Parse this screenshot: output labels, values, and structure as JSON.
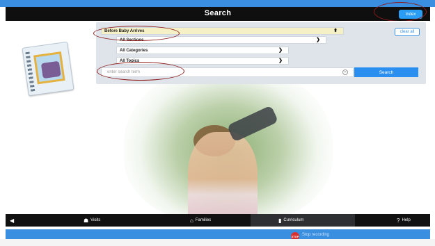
{
  "header": {
    "title": "Search",
    "index_label": "Index"
  },
  "filters": {
    "primary": {
      "value": "Before Baby Arrives"
    },
    "sections": {
      "value": "All Sections"
    },
    "categories": {
      "value": "All Categories"
    },
    "topics": {
      "value": "All Topics"
    },
    "clear_all": "clear all"
  },
  "search": {
    "placeholder": "enter search term",
    "button": "Search"
  },
  "bottom_nav": {
    "back": "back-icon",
    "items": [
      {
        "label": "Visits",
        "icon": "binoculars-icon"
      },
      {
        "label": "Families",
        "icon": "home-icon"
      },
      {
        "label": "Curriculum",
        "icon": "book-icon",
        "active": true
      },
      {
        "label": "Help",
        "icon": "question-circle-icon"
      }
    ]
  },
  "status": {
    "text": "Stop recording"
  },
  "colors": {
    "accent": "#2a8ff0",
    "header": "#0f0f0f",
    "annotation": "#8c1b1b"
  }
}
